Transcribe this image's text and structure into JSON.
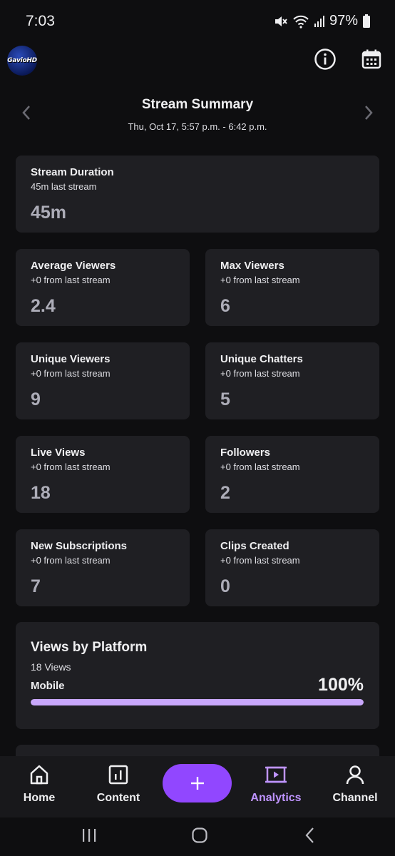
{
  "status": {
    "time": "7:03",
    "battery": "97%"
  },
  "header": {
    "avatar_text": "GavioHD"
  },
  "summary": {
    "title": "Stream Summary",
    "date_range": "Thu, Oct 17, 5:57 p.m. - 6:42 p.m."
  },
  "stats": {
    "duration": {
      "title": "Stream Duration",
      "sub": "45m last stream",
      "value": "45m"
    },
    "avg_viewers": {
      "title": "Average Viewers",
      "sub": "+0 from last stream",
      "value": "2.4"
    },
    "max_viewers": {
      "title": "Max Viewers",
      "sub": "+0 from last stream",
      "value": "6"
    },
    "unique_viewers": {
      "title": "Unique Viewers",
      "sub": "+0 from last stream",
      "value": "9"
    },
    "unique_chatters": {
      "title": "Unique Chatters",
      "sub": "+0 from last stream",
      "value": "5"
    },
    "live_views": {
      "title": "Live Views",
      "sub": "+0 from last stream",
      "value": "18"
    },
    "followers": {
      "title": "Followers",
      "sub": "+0 from last stream",
      "value": "2"
    },
    "new_subs": {
      "title": "New Subscriptions",
      "sub": "+0 from last stream",
      "value": "7"
    },
    "clips": {
      "title": "Clips Created",
      "sub": "+0 from last stream",
      "value": "0"
    }
  },
  "platform": {
    "title": "Views by Platform",
    "views": "18 Views",
    "label": "Mobile",
    "percent_text": "100%",
    "percent": 100
  },
  "nav": {
    "home": "Home",
    "content": "Content",
    "analytics": "Analytics",
    "channel": "Channel"
  },
  "colors": {
    "accent": "#9147ff",
    "accent_light": "#bf94ff",
    "bar_fill": "#c8a7fb",
    "card_bg": "#1f1f23",
    "page_bg": "#0e0e10"
  }
}
